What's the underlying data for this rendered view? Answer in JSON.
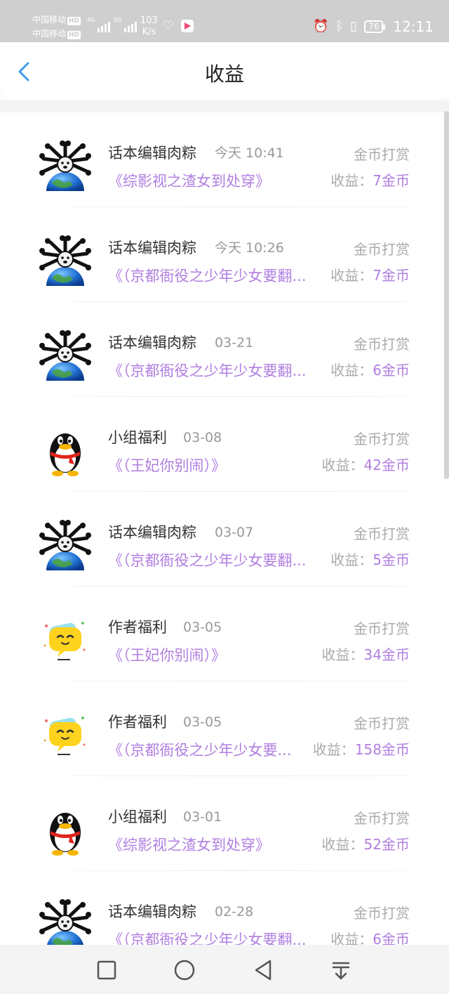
{
  "status_bar": {
    "carrier_1": "中国移动",
    "carrier_2": "中国移动",
    "hd_badge": "HD",
    "network_1": "4G",
    "network_2": "5G",
    "speed_value": "103",
    "speed_unit": "K/s",
    "battery": "76",
    "time": "12:11",
    "icons": [
      "heart-icon",
      "video-app-icon",
      "alarm-icon",
      "bluetooth-icon",
      "vibrate-icon"
    ]
  },
  "header": {
    "title": "收益",
    "back_icon": "chevron-left-icon"
  },
  "earnings_label": "收益：",
  "items": [
    {
      "name": "话本编辑肉粽",
      "time": "今天 10:41",
      "type": "金币打赏",
      "book": "《综影视之渣女到处穿》",
      "earning": "7金币",
      "avatar": "creature-globe"
    },
    {
      "name": "话本编辑肉粽",
      "time": "今天 10:26",
      "type": "金币打赏",
      "book": "《（京都衙役之少年少女要翻...",
      "earning": "7金币",
      "avatar": "creature-globe"
    },
    {
      "name": "话本编辑肉粽",
      "time": "03-21",
      "type": "金币打赏",
      "book": "《（京都衙役之少年少女要翻...",
      "earning": "6金币",
      "avatar": "creature-globe"
    },
    {
      "name": "小组福利",
      "time": "03-08",
      "type": "金币打赏",
      "book": "《（王妃你别闹）》",
      "earning": "42金币",
      "avatar": "penguin"
    },
    {
      "name": "话本编辑肉粽",
      "time": "03-07",
      "type": "金币打赏",
      "book": "《（京都衙役之少年少女要翻...",
      "earning": "5金币",
      "avatar": "creature-globe"
    },
    {
      "name": "作者福利",
      "time": "03-05",
      "type": "金币打赏",
      "book": "《（王妃你别闹）》",
      "earning": "34金币",
      "avatar": "yellow-chat"
    },
    {
      "name": "作者福利",
      "time": "03-05",
      "type": "金币打赏",
      "book": "《（京都衙役之少年少女要...",
      "earning": "158金币",
      "avatar": "yellow-chat"
    },
    {
      "name": "小组福利",
      "time": "03-01",
      "type": "金币打赏",
      "book": "《综影视之渣女到处穿》",
      "earning": "52金币",
      "avatar": "penguin"
    },
    {
      "name": "话本编辑肉粽",
      "time": "02-28",
      "type": "金币打赏",
      "book": "《（京都衙役之少年少女要翻...",
      "earning": "6金币",
      "avatar": "creature-globe"
    }
  ],
  "nav_bar": {
    "buttons": [
      "recent-apps-icon",
      "home-icon",
      "back-triangle-icon",
      "notification-pull-icon"
    ]
  },
  "colors": {
    "accent_purple": "#b07ee0",
    "back_blue": "#3d9bf0",
    "status_bar_bg": "#cfcfcf"
  }
}
